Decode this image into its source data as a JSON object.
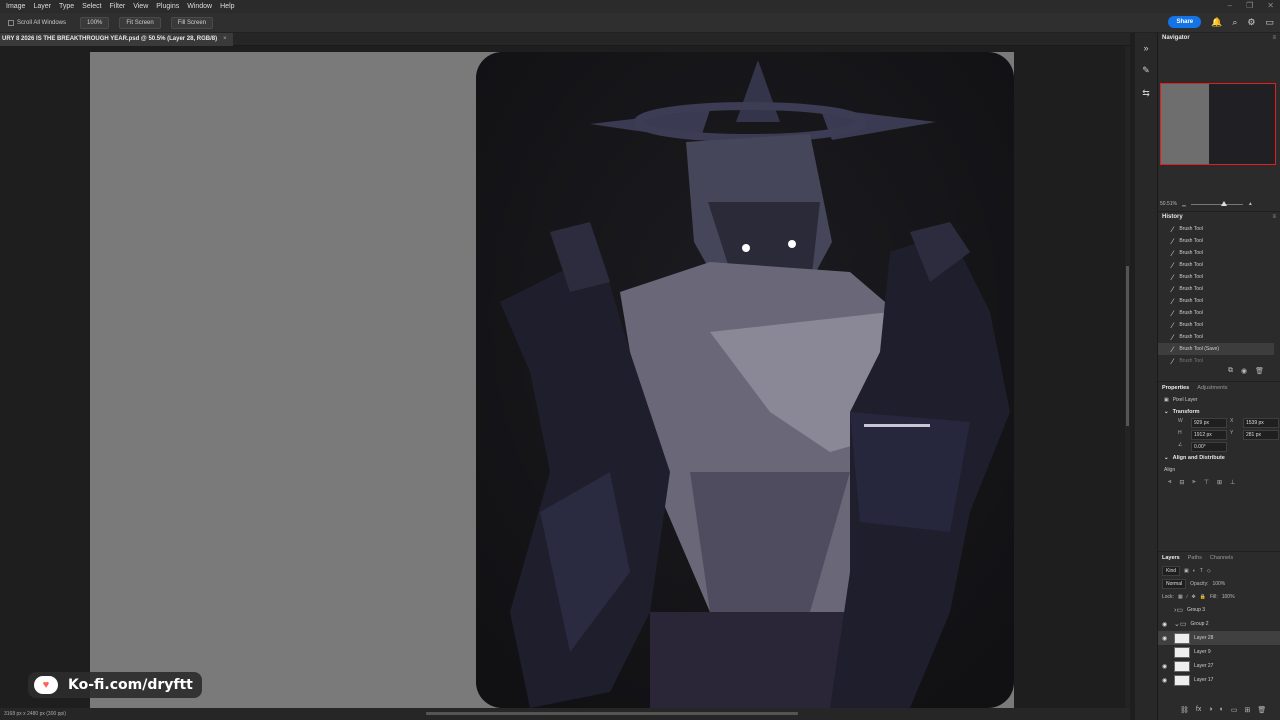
{
  "menubar": {
    "items": [
      "Image",
      "Layer",
      "Type",
      "Select",
      "Filter",
      "View",
      "Plugins",
      "Window",
      "Help"
    ]
  },
  "options": {
    "scroll_all": "Scroll All Windows",
    "zoom_btn": "100%",
    "fit_btn": "Fit Screen",
    "fill_btn": "Fill Screen",
    "share": "Share"
  },
  "document": {
    "tab_title": "URY 8 2026 IS THE BREAKTHROUGH YEAR.psd @ 50.5% (Layer 28, RGB/8)",
    "status": "3168 px x 2480 px (300 ppi)"
  },
  "watermark": {
    "text": "Ko-fi.com/dryftt"
  },
  "navigator": {
    "title": "Navigator",
    "zoom": "50.51%"
  },
  "history": {
    "title": "History",
    "items": [
      "Brush Tool",
      "Brush Tool",
      "Brush Tool",
      "Brush Tool",
      "Brush Tool",
      "Brush Tool",
      "Brush Tool",
      "Brush Tool",
      "Brush Tool",
      "Brush Tool",
      "Brush Tool (Save)",
      "Brush Tool"
    ]
  },
  "properties": {
    "tabs": [
      "Properties",
      "Adjustments"
    ],
    "kind": "Pixel Layer",
    "transform_label": "Transform",
    "w_label": "W",
    "w_value": "929 px",
    "h_label": "H",
    "h_value": "1912 px",
    "x_label": "X",
    "x_value": "1539 px",
    "y_label": "Y",
    "y_value": "281 px",
    "angle": "0.00°",
    "align_label": "Align and Distribute",
    "align_sub": "Align"
  },
  "layers": {
    "tabs": [
      "Layers",
      "Paths",
      "Channels"
    ],
    "filter": "Kind",
    "blend": "Normal",
    "opacity_label": "Opacity:",
    "opacity": "100%",
    "lock_label": "Lock:",
    "fill_label": "Fill:",
    "fill": "100%",
    "items": [
      "Group 3",
      "Group 2",
      "Layer 28",
      "Layer 9",
      "Layer 27",
      "Layer 17"
    ]
  }
}
